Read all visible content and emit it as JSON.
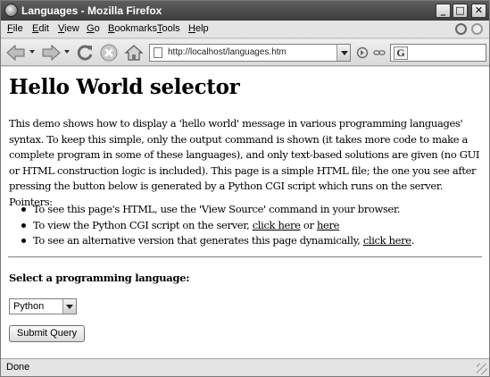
{
  "window": {
    "title": "Languages - Mozilla Firefox"
  },
  "menu": {
    "items": [
      "File",
      "Edit",
      "View",
      "Go",
      "Bookmarks",
      "Tools",
      "Help"
    ]
  },
  "toolbar": {
    "url": "http://localhost/languages.htm"
  },
  "content": {
    "heading": "Hello World selector",
    "intro": "This demo shows how to display a 'hello world' message in various programming languages' syntax. To keep this simple, only the output command is shown (it takes more code to make a complete program in some of these languages), and only text-based solutions are given (no GUI or HTML construction logic is included). This page is a simple HTML file; the one you see after pressing the button below is generated by a Python CGI script which runs on the server. Pointers:",
    "pointers": {
      "item1": "To see this page's HTML, use the 'View Source' command in your browser.",
      "item2_prefix": "To view the Python CGI script on the server, ",
      "item2_link1": "click here",
      "item2_mid": " or ",
      "item2_link2": "here",
      "item3_prefix": "To see an alternative version that generates this page dynamically, ",
      "item3_link": "click here",
      "item3_suffix": "."
    },
    "form": {
      "label": "Select a programming language:",
      "selected_language": "Python",
      "submit_label": "Submit Query"
    }
  },
  "status": {
    "text": "Done"
  },
  "icons": [
    "firefox-app-icon",
    "back-arrow-icon",
    "forward-arrow-icon",
    "reload-icon",
    "stop-icon",
    "home-icon",
    "page-icon",
    "go-icon",
    "google-search-icon"
  ]
}
